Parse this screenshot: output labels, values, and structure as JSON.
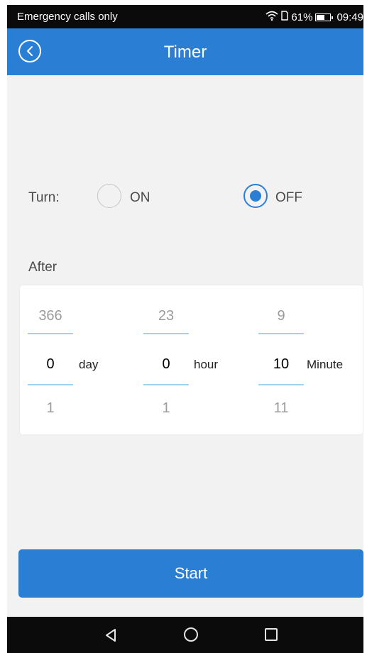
{
  "status_bar": {
    "carrier": "Emergency calls only",
    "battery": "61%",
    "battery_level": 0.61,
    "time": "09:49",
    "icons": [
      "wifi-icon",
      "sim-icon",
      "battery-icon"
    ]
  },
  "app_bar": {
    "title": "Timer",
    "back_icon": "back-circle-icon"
  },
  "turn": {
    "label": "Turn:",
    "options": [
      {
        "label": "ON",
        "selected": false
      },
      {
        "label": "OFF",
        "selected": true
      }
    ]
  },
  "after_label": "After",
  "picker": {
    "columns": [
      {
        "prev": "366",
        "value": "0",
        "next": "1",
        "unit": "day"
      },
      {
        "prev": "23",
        "value": "0",
        "next": "1",
        "unit": "hour"
      },
      {
        "prev": "9",
        "value": "10",
        "next": "11",
        "unit": "Minute"
      }
    ]
  },
  "start_button": "Start",
  "colors": {
    "primary": "#2a7fd4",
    "background": "#f2f2f2",
    "picker_line": "#9fd3ef"
  },
  "nav_bar": {
    "icons": [
      "nav-back-icon",
      "nav-home-icon",
      "nav-recent-icon"
    ]
  }
}
